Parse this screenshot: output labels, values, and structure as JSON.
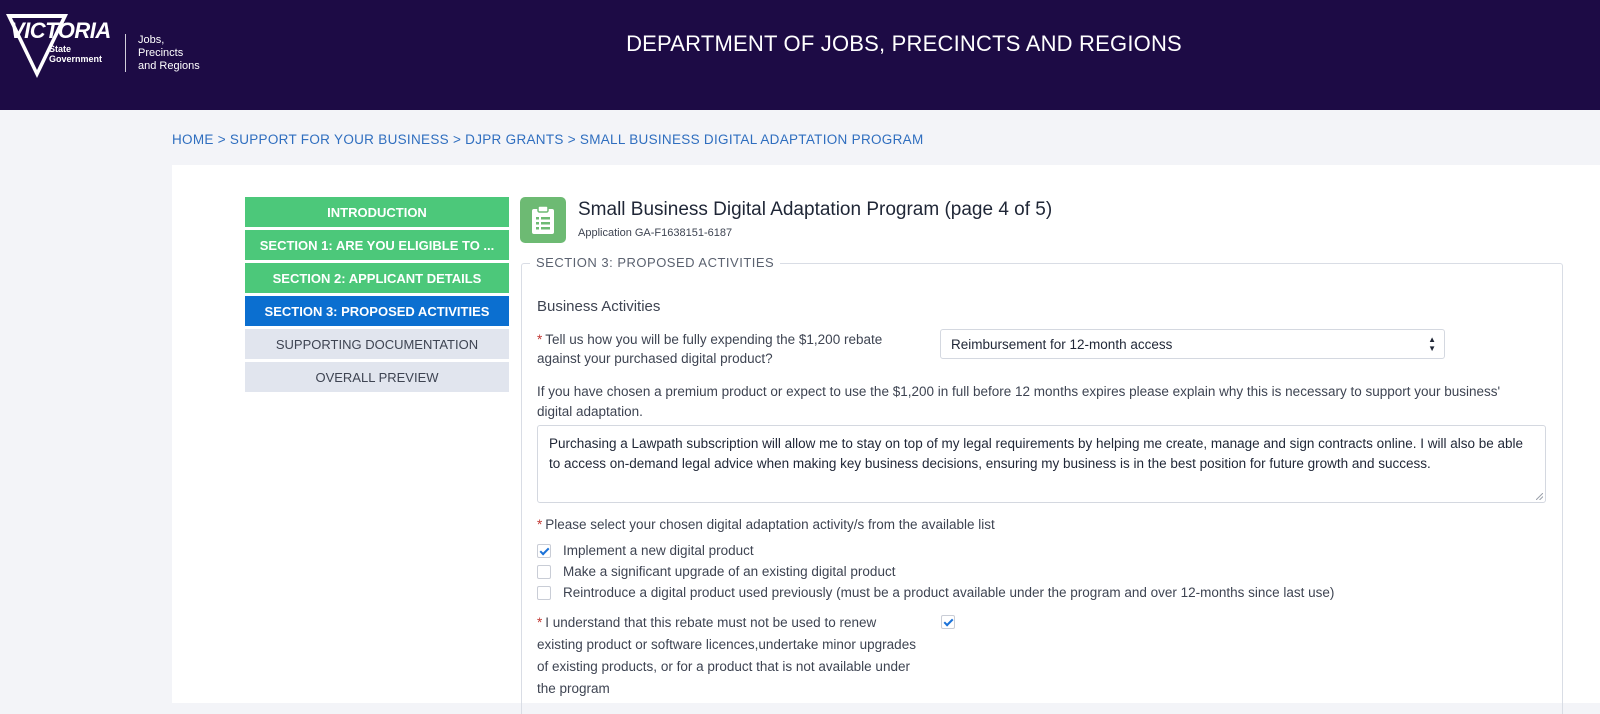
{
  "header": {
    "logo_title": "VICTORIA",
    "logo_sub_1": "State",
    "logo_sub_2": "Government",
    "dept_line_1": "Jobs,",
    "dept_line_2": "Precincts",
    "dept_line_3": "and Regions",
    "title": "DEPARTMENT OF JOBS, PRECINCTS AND REGIONS",
    "bg_color": "#1d0b45"
  },
  "breadcrumb": {
    "items": [
      "HOME",
      "SUPPORT FOR YOUR BUSINESS",
      "DJPR GRANTS",
      "SMALL BUSINESS DIGITAL ADAPTATION PROGRAM"
    ],
    "separator": ">"
  },
  "nav": {
    "items": [
      {
        "label": "INTRODUCTION",
        "state": "done"
      },
      {
        "label": "SECTION 1: ARE YOU ELIGIBLE TO ...",
        "state": "done"
      },
      {
        "label": "SECTION 2: APPLICANT DETAILS",
        "state": "done"
      },
      {
        "label": "SECTION 3: PROPOSED ACTIVITIES",
        "state": "active"
      },
      {
        "label": "SUPPORTING DOCUMENTATION",
        "state": "todo"
      },
      {
        "label": "OVERALL PREVIEW",
        "state": "todo"
      }
    ]
  },
  "form": {
    "icon": "clipboard-icon",
    "title": "Small Business Digital Adaptation Program (page 4 of 5)",
    "application": "Application GA-F1638151-6187",
    "section_legend": "SECTION 3: PROPOSED ACTIVITIES",
    "sub_heading": "Business Activities",
    "required_mark": "*",
    "q1_label": "Tell us how you will be fully expending the $1,200 rebate against your purchased digital product?",
    "q1_value": "Reimbursement for 12-month access",
    "explain_label": "If you have chosen a premium product or expect to use the $1,200 in full before 12 months expires please explain why this is necessary to support your business' digital adaptation.",
    "explain_value": "Purchasing a Lawpath subscription will allow me to stay on top of my legal requirements by helping me create, manage and sign contracts online. I will also be able to access on-demand legal advice when making key business decisions, ensuring my business is in the best position for future growth and success.",
    "q2_label": "Please select your chosen digital adaptation activity/s from the available list",
    "activities": [
      {
        "label": "Implement a new digital product",
        "checked": true
      },
      {
        "label": "Make a significant upgrade of an existing digital product",
        "checked": false
      },
      {
        "label": "Reintroduce a digital product used previously (must be a product available under the program and over 12-months since last use)",
        "checked": false
      }
    ],
    "q3_label": "I understand that this rebate must not be used to renew existing product or software licences,undertake minor upgrades of existing products, or for a product that is not available under the program",
    "q3_checked": true
  },
  "colors": {
    "done": "#4cc87a",
    "active": "#0b6fd0",
    "todo": "#e1e5ee",
    "link": "#2f6ebf",
    "required": "#c23934"
  }
}
